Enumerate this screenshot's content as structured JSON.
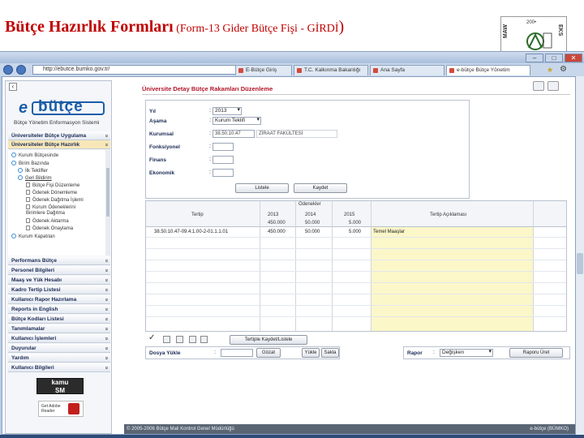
{
  "slide": {
    "title_main": "Bütçe Hazırlık Formları",
    "title_sub": " (Form-13 Gider Bütçe Fişi - GİRDİ",
    "title_close": ")",
    "logo_year": "200•",
    "logo_left": "MAW",
    "logo_right": "EKS"
  },
  "browser": {
    "address": "http://ebutce.bumko.gov.tr/",
    "tabs": [
      {
        "label": "E-Bütçe Giriş",
        "active": false
      },
      {
        "label": "T.C. Kalkınma Bakanlığı",
        "active": false
      },
      {
        "label": "Ana Sayfa",
        "active": false
      },
      {
        "label": "e-bütçe Bütçe Yönetim",
        "active": true
      }
    ]
  },
  "sidebar": {
    "logo_text": "bütçe",
    "logo_prefix": "e",
    "subtitle": "Bütçe Yönetim Enformasyon Sistemi",
    "top_sections": [
      "Üniversiteler Bütçe Uygulama",
      "Üniversiteler Bütçe Hazırlık"
    ],
    "tree": [
      "Kurum Bütçesinde",
      "Birim Bazında",
      "İlk Teklifler",
      "Geri Bildirim",
      "Bütçe Fişi Düzenleme",
      "Ödenek Dönemleme",
      "Ödenek Dağıtma İşlemi",
      "Kurum Ödeneklerini Birimlere Dağıtma",
      "Ödenek Aktarma",
      "Ödenek Onaylama",
      "Kurum Kapatılan"
    ],
    "sections": [
      "Performans Bütçe",
      "Personel Bilgileri",
      "Maaş ve Yük Hesabı",
      "Kadro Tertip Listesi",
      "Kullanıcı Rapor Hazırlama",
      "Reports in English",
      "Bütçe Kodları Listesi",
      "Tanımlamalar",
      "Kullanıcı İşlemleri",
      "Duyurular",
      "Yardım",
      "Kullanıcı Bilgileri"
    ],
    "kamu_line1": "kamu",
    "kamu_line2": "SM",
    "adobe_line1": "Get Adobe",
    "adobe_line2": "Reader"
  },
  "form": {
    "title": "Üniversite Detay Bütçe Rakamları Düzenleme",
    "fields": {
      "yil_label": "Yıl",
      "yil_value": "2013",
      "asama_label": "Aşama",
      "asama_value": "Kurum Teklifi",
      "kurumsal_label": "Kurumsal",
      "kurumsal_code": "38.50.10.47",
      "kurumsal_name": "ZİRAAT FAKÜLTESİ",
      "fonksiyonel_label": "Fonksiyonel",
      "finans_label": "Finans",
      "ekonomik_label": "Ekonomik"
    },
    "buttons": {
      "listele": "Listele",
      "kaydet": "Kaydet"
    }
  },
  "grid": {
    "group_header": "Ödenekler",
    "columns": {
      "tertip": "Tertip",
      "y2013": "2013",
      "y2014": "2014",
      "y2015": "2015",
      "aciklama": "Tertip Açıklaması"
    },
    "totals": {
      "y2013": "450.000",
      "y2014": "50.000",
      "y2015": "5.000"
    },
    "rows": [
      {
        "tertip": "38.50.10.47-09.4.1.00-2-01.1.1.01",
        "y2013": "450.000",
        "y2014": "50.000",
        "y2015": "5.000",
        "aciklama": "Temel Maaşlar"
      }
    ],
    "tools_button": "Tertiple Kaydet/Listele"
  },
  "dosya": {
    "label": "Dosya Yükle",
    "gozat": "Gözat",
    "yukle": "Yükle",
    "sakla": "Sakla"
  },
  "raporlar": {
    "label": "Rapor",
    "select": "Değişken",
    "button": "Raporu Üret"
  },
  "footer": {
    "left": "© 2005-2006 Bütçe Mali Kontrol Genel Müdürlüğü",
    "right": "e-bütçe (BÜMKO)"
  },
  "colors": {
    "accent": "#1c5ea8",
    "title_red": "#c00000",
    "form_title": "#b1172a"
  }
}
